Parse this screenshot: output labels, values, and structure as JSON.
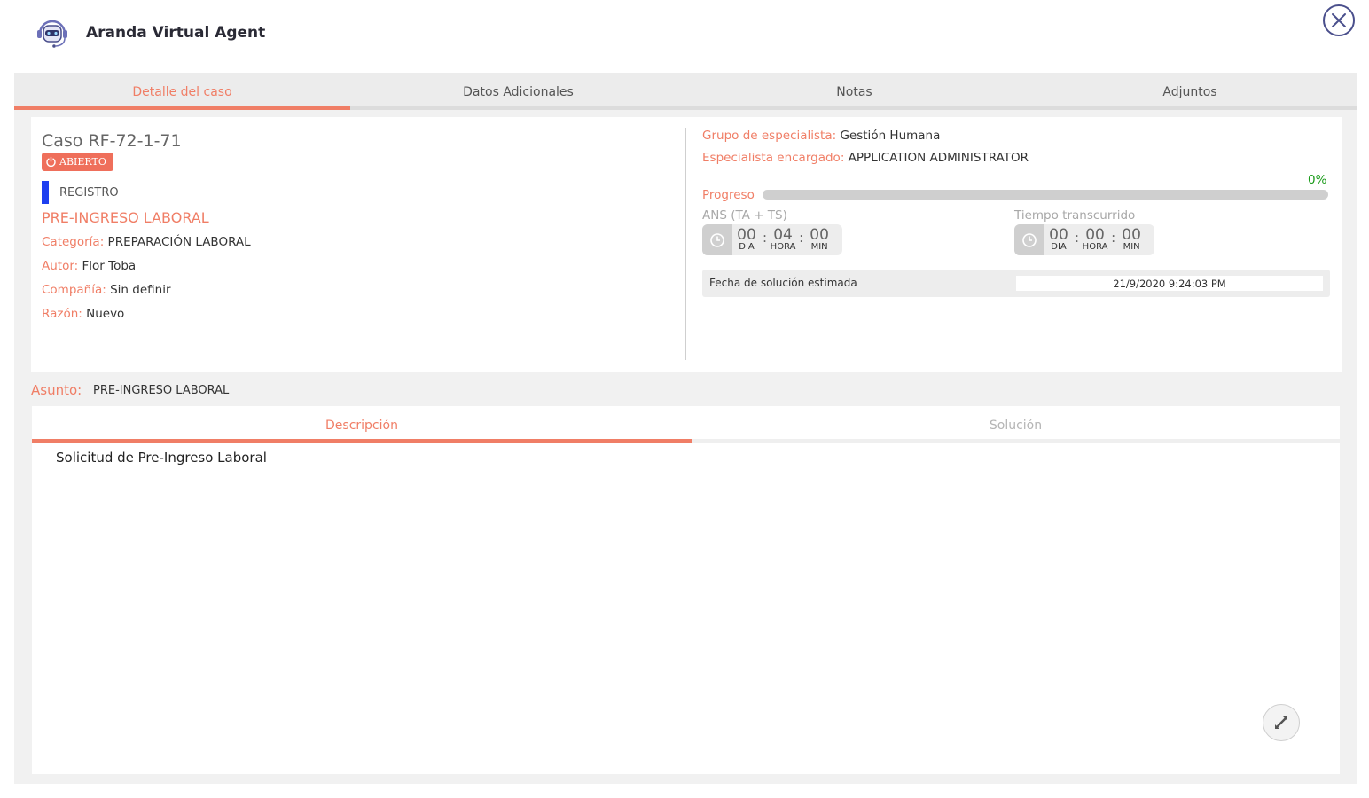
{
  "app": {
    "title": "Aranda Virtual Agent",
    "logo_icon": "robot-headset-icon"
  },
  "colors": {
    "accent": "#f07e66",
    "badge": "#ef6f5b",
    "stage": "#1e3ff0",
    "progress": "#1a9b1a"
  },
  "tabs": [
    {
      "label": "Detalle del caso",
      "active": true
    },
    {
      "label": "Datos Adicionales",
      "active": false
    },
    {
      "label": "Notas",
      "active": false
    },
    {
      "label": "Adjuntos",
      "active": false
    }
  ],
  "case": {
    "title": "Caso RF-72-1-71",
    "status": "ABIERTO",
    "stage": "REGISTRO",
    "service": "PRE-INGRESO LABORAL",
    "fields": [
      {
        "label": "Categoría:",
        "value": "PREPARACIÓN LABORAL"
      },
      {
        "label": "Autor:",
        "value": "Flor Toba"
      },
      {
        "label": "Compañía:",
        "value": "Sin definir"
      },
      {
        "label": "Razón:",
        "value": "Nuevo"
      }
    ]
  },
  "assignment": {
    "group_label": "Grupo de especialista:",
    "group_value": "Gestión Humana",
    "specialist_label": "Especialista encargado:",
    "specialist_value": "APPLICATION ADMINISTRATOR"
  },
  "progress": {
    "label": "Progreso",
    "percent_text": "0%",
    "percent": 0
  },
  "timers": {
    "ans": {
      "label": "ANS (TA + TS)",
      "dia": "00",
      "hora": "04",
      "min": "00"
    },
    "elapsed": {
      "label": "Tiempo transcurrido",
      "dia": "00",
      "hora": "00",
      "min": "00"
    },
    "units": {
      "dia": "DIA",
      "hora": "HORA",
      "min": "MIN"
    }
  },
  "estimate": {
    "label": "Fecha de solución estimada",
    "value": "21/9/2020 9:24:03 PM"
  },
  "subject": {
    "label": "Asunto:",
    "value": "PRE-INGRESO LABORAL"
  },
  "detail_tabs": [
    {
      "label": "Descripción",
      "active": true
    },
    {
      "label": "Solución",
      "active": false
    }
  ],
  "description": "Solicitud de Pre-Ingreso Laboral"
}
